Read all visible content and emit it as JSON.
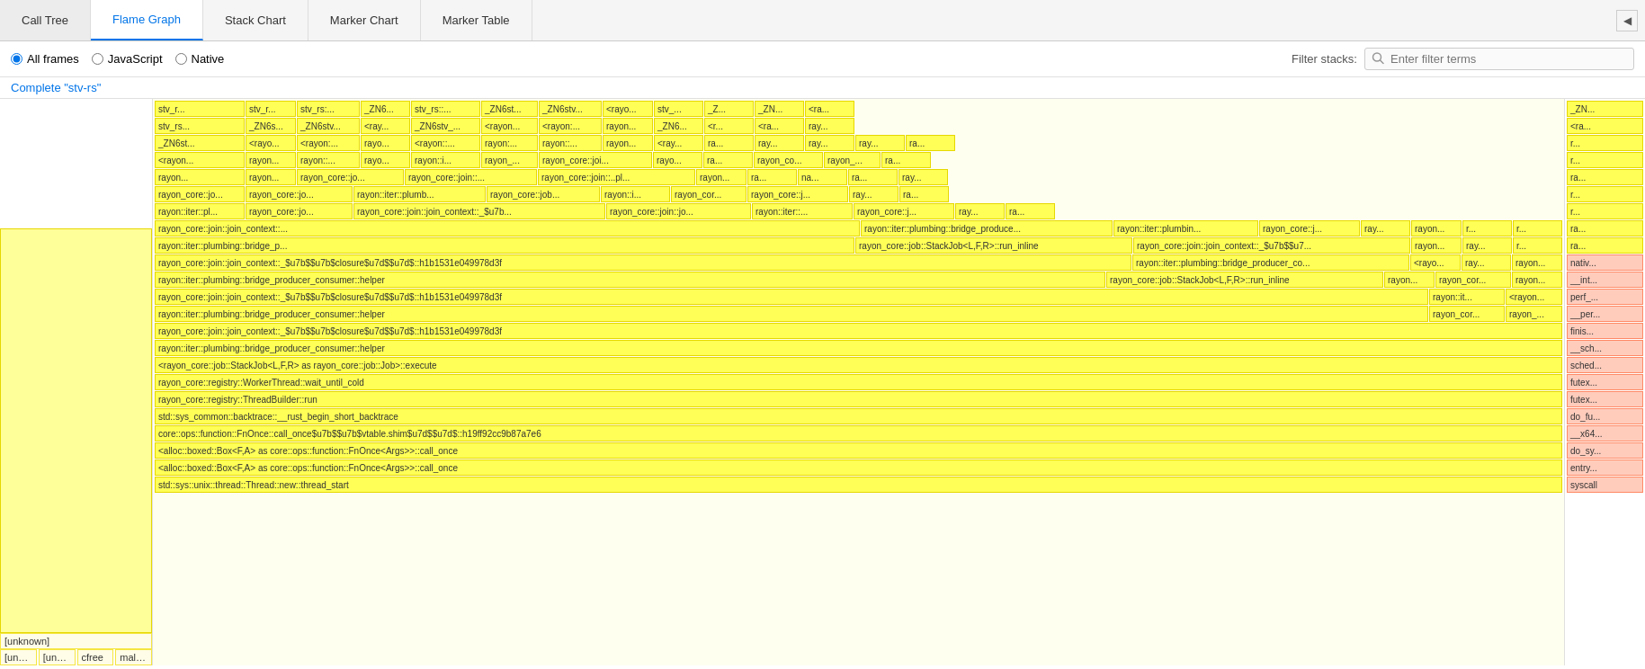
{
  "tabs": [
    {
      "label": "Call Tree",
      "active": false
    },
    {
      "label": "Flame Graph",
      "active": true
    },
    {
      "label": "Stack Chart",
      "active": false
    },
    {
      "label": "Marker Chart",
      "active": false
    },
    {
      "label": "Marker Table",
      "active": false
    }
  ],
  "toolbar": {
    "frame_options": [
      {
        "label": "All frames",
        "selected": true
      },
      {
        "label": "JavaScript",
        "selected": false
      },
      {
        "label": "Native",
        "selected": false
      }
    ],
    "filter_label": "Filter stacks:",
    "filter_placeholder": "Enter filter terms"
  },
  "breadcrumb": "Complete \"stv-rs\"",
  "collapse_button_label": "◀",
  "flame_rows": [
    [
      "stv_r...",
      "stv_r...",
      "stv_rs:...",
      "_ZN6...",
      "stv_rs::...",
      "_ZN6st...",
      "_ZN6stv...",
      "<rayo...",
      "stv_...",
      "_Z...",
      "_ZN...",
      "<ra...",
      "_ZN..."
    ],
    [
      "stv_rs...",
      "_ZN6s...",
      "_ZN6stv...",
      "<ray...",
      "_ZN6stv_...",
      "<rayon...",
      "<rayon:...",
      "rayon...",
      "_ZN6...",
      "<r...",
      "<ra...",
      "ray...",
      "<ra..."
    ],
    [
      "_ZN6st...",
      "<rayo...",
      "<rayon:...",
      "rayo...",
      "<rayon::...",
      "rayon:...",
      "rayon::...",
      "rayon...",
      "<ray...",
      "ra...",
      "ray...",
      "ray...",
      "ray...",
      "ra...",
      "r..."
    ],
    [
      "<rayon...",
      "rayon...",
      "rayon::...",
      "rayo...",
      "rayon::i...",
      "rayon_...",
      "rayon_core::joi...",
      "rayo...",
      "ra...",
      "rayon_co...",
      "rayon_...",
      "ra...",
      "r..."
    ],
    [
      "rayon...",
      "rayon...",
      "rayon_core::jo...",
      "rayon_core::join::...",
      "rayon_core::join::..pl...",
      "rayon...",
      "ra...",
      "na...",
      "ra...",
      "ray...",
      "ra..."
    ],
    [
      "rayon_core::jo...",
      "rayon_core::jo...",
      "rayon::iter::plumb...",
      "rayon_core::job...",
      "rayon::i...",
      "rayon_cor...",
      "rayon_core::j...",
      "ray...",
      "ra...",
      "r..."
    ],
    [
      "rayon::iter::pl...",
      "rayon_core::jo...",
      "rayon_core::join::join_context::_$u7b...",
      "rayon_core::join::jo...",
      "rayon::iter::...",
      "rayon_core::j...",
      "ray...",
      "ra...",
      "r..."
    ],
    [
      "rayon_core::join::join_context::...",
      "rayon::iter::plumbing::bridge_produce...",
      "rayon::iter::plumbin...",
      "rayon_core::j...",
      "ray...",
      "rayon...",
      "r...",
      "r...",
      "ra..."
    ],
    [
      "rayon::iter::plumbing::bridge_p...",
      "rayon_core::job::StackJob<L,F,R>::run_inline",
      "rayon_core::join::join_context::_$u7b$$u7...",
      "rayon...",
      "ray...",
      "r...",
      "ra..."
    ],
    [
      "rayon_core::join::join_context::_$u7b$$u7b$closure$u7d$$u7d$::h1b1531e049978d3f",
      "rayon::iter::plumbing::bridge_producer_co...",
      "<rayo...",
      "ray...",
      "rayon...",
      "nativ..."
    ],
    [
      "rayon::iter::plumbing::bridge_producer_consumer::helper",
      "rayon_core::job::StackJob<L,F,R>::run_inline",
      "rayon...",
      "rayon_cor...",
      "rayon...",
      "__int..."
    ],
    [
      "rayon_core::join::join_context::_$u7b$$u7b$closure$u7d$$u7d$::h1b1531e049978d3f",
      "rayon::it...",
      "<rayon...",
      "perf_..."
    ],
    [
      "rayon::iter::plumbing::bridge_producer_consumer::helper",
      "rayon_cor...",
      "rayon_...",
      "__per..."
    ],
    [
      "rayon_core::join::join_context::_$u7b$$u7b$closure$u7d$$u7d$::h1b1531e049978d3f",
      "finis..."
    ],
    [
      "rayon::iter::plumbing::bridge_producer_consumer::helper",
      "__sch..."
    ],
    [
      "<rayon_core::job::StackJob<L,F,R> as rayon_core::job::Job>::execute",
      "sched..."
    ],
    [
      "rayon_core::registry::WorkerThread::wait_until_cold",
      "futex..."
    ],
    [
      "rayon_core::registry::ThreadBuilder::run",
      "futex..."
    ],
    [
      "std::sys_common::backtrace::__rust_begin_short_backtrace",
      "do_fu..."
    ],
    [
      "core::ops::function::FnOnce::call_once$u7b$$u7b$vtable.shim$u7d$$u7d$::h19ff92cc9b87a7e6",
      "__x64..."
    ],
    [
      "<alloc::boxed::Box<F,A> as core::ops::function::FnOnce<Args>>::call_once",
      "do_sy..."
    ],
    [
      "<alloc::boxed::Box<F,A> as core::ops::function::FnOnce<Args>>::call_once",
      "entry..."
    ],
    [
      "std::sys::unix::thread::Thread::new::thread_start",
      "syscall"
    ]
  ],
  "left_items": [
    {
      "label": "[unknown]"
    },
    {
      "label": "[unkno..."
    },
    {
      "label": "[unknown]"
    },
    {
      "label": "cfree"
    },
    {
      "label": "malloc"
    }
  ]
}
